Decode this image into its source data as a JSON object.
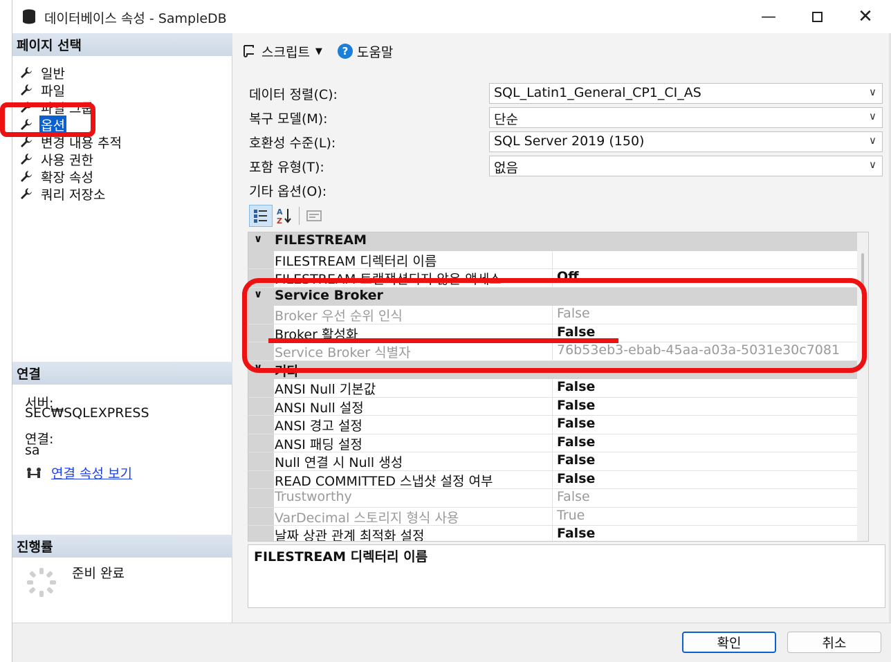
{
  "window": {
    "title": "데이터베이스 속성 - SampleDB",
    "min_glyph": "—",
    "close_glyph": "✕"
  },
  "left": {
    "page_select_header": "페이지 선택",
    "nav_items": [
      {
        "label": "일반",
        "selected": false
      },
      {
        "label": "파일",
        "selected": false
      },
      {
        "label": "파일 그룹",
        "selected": false
      },
      {
        "label": "옵션",
        "selected": true
      },
      {
        "label": "변경 내용 추적",
        "selected": false
      },
      {
        "label": "사용 권한",
        "selected": false
      },
      {
        "label": "확장 속성",
        "selected": false
      },
      {
        "label": "쿼리 저장소",
        "selected": false
      }
    ],
    "connection_header": "연결",
    "server_label": "서버:",
    "server_value": "SEC₩SQLEXPRESS",
    "conn_label": "연결:",
    "conn_value": "sa",
    "view_conn_props": "연결 속성 보기",
    "progress_header": "진행률",
    "progress_status": "준비 완료"
  },
  "toolbar": {
    "script_label": "스크립트",
    "help_label": "도움말"
  },
  "fields": [
    {
      "label": "데이터 정렬(C):",
      "value": "SQL_Latin1_General_CP1_CI_AS"
    },
    {
      "label": "복구 모델(M):",
      "value": "단순"
    },
    {
      "label": "호환성 수준(L):",
      "value": "SQL Server 2019 (150)"
    },
    {
      "label": "포함 유형(T):",
      "value": "없음"
    }
  ],
  "other_options_label": "기타 옵션(O):",
  "grid": {
    "rows": [
      {
        "kind": "cat",
        "name": "FILESTREAM",
        "toggle": "∨"
      },
      {
        "kind": "prop",
        "name": "FILESTREAM 디렉터리 이름",
        "value": "",
        "bold": false,
        "dim": false
      },
      {
        "kind": "prop",
        "name": "FILESTREAM 트랜잭션되지 않은 액세스",
        "value": "Off",
        "bold": true,
        "dim": false
      },
      {
        "kind": "cat",
        "name": "Service Broker",
        "toggle": "∨"
      },
      {
        "kind": "prop",
        "name": "Broker 우선 순위 인식",
        "value": "False",
        "bold": false,
        "dim": true
      },
      {
        "kind": "prop",
        "name": "Broker 활성화",
        "value": "False",
        "bold": true,
        "dim": false
      },
      {
        "kind": "prop",
        "name": "Service Broker 식별자",
        "value": "76b53eb3-ebab-45aa-a03a-5031e30c7081",
        "bold": false,
        "dim": true
      },
      {
        "kind": "cat",
        "name": "기타",
        "toggle": "∨"
      },
      {
        "kind": "prop",
        "name": "ANSI Null 기본값",
        "value": "False",
        "bold": true,
        "dim": false
      },
      {
        "kind": "prop",
        "name": "ANSI Null 설정",
        "value": "False",
        "bold": true,
        "dim": false
      },
      {
        "kind": "prop",
        "name": "ANSI 경고 설정",
        "value": "False",
        "bold": true,
        "dim": false
      },
      {
        "kind": "prop",
        "name": "ANSI 패딩 설정",
        "value": "False",
        "bold": true,
        "dim": false
      },
      {
        "kind": "prop",
        "name": "Null 연결 시 Null 생성",
        "value": "False",
        "bold": true,
        "dim": false
      },
      {
        "kind": "prop",
        "name": "READ COMMITTED 스냅샷 설정 여부",
        "value": "False",
        "bold": true,
        "dim": false
      },
      {
        "kind": "prop",
        "name": "Trustworthy",
        "value": "False",
        "bold": false,
        "dim": true
      },
      {
        "kind": "prop",
        "name": "VarDecimal 스토리지 형식 사용",
        "value": "True",
        "bold": false,
        "dim": true
      },
      {
        "kind": "prop",
        "name": "날짜 상관 관계 최적화 설정",
        "value": "False",
        "bold": true,
        "dim": false
      }
    ]
  },
  "description": "FILESTREAM 디렉터리 이름",
  "buttons": {
    "ok": "확인",
    "cancel": "취소"
  },
  "colors": {
    "selection": "#0a5fd1",
    "annotation": "#ee1111",
    "link": "#1a3ff0"
  }
}
